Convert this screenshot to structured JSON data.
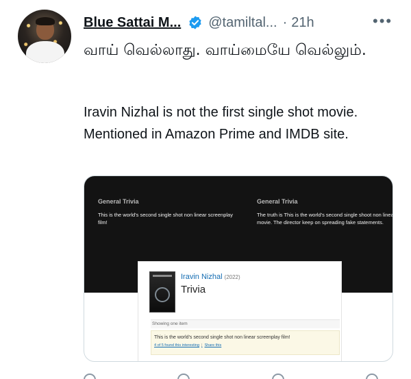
{
  "tweet": {
    "display_name": "Blue Sattai M...",
    "handle": "@tamiltal...",
    "separator": "·",
    "time": "21h",
    "more_label": "•••",
    "text_tamil": "வாய் வெல்லாது. வாய்மையே வெல்லும்.",
    "text_english": "Iravin Nizhal is not the first single shot movie. Mentioned in Amazon Prime and IMDB site."
  },
  "card": {
    "left_column": {
      "heading": "General Trivia",
      "text": "This is the world's second single shot non linear screenplay film!"
    },
    "right_column": {
      "heading": "General Trivia",
      "text": "The truth is This is the world's second single shoot non linear movie. The director keep on spreading fake statements."
    },
    "imdb": {
      "movie_title": "Iravin Nizhal",
      "year": "(2022)",
      "section_title": "Trivia",
      "showing": "Showing one item",
      "item_text": "This is the world's second single shot non linear screenplay film!",
      "interesting_link": "4 of 5 found this interesting",
      "link_separator": "|",
      "share_link": "Share this"
    }
  },
  "colors": {
    "verified": "#1d9bf0",
    "link": "#136cb2",
    "muted": "#536471"
  }
}
